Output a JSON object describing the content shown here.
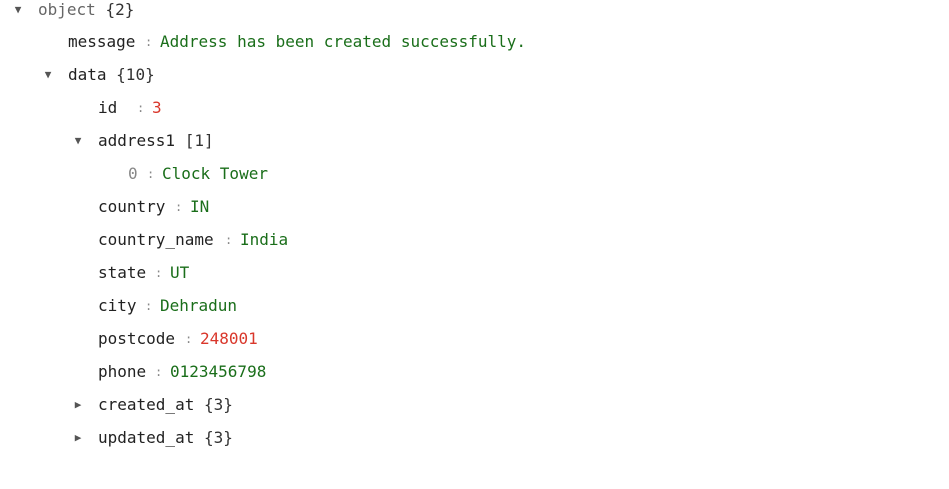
{
  "icons": {
    "expanded": "▼",
    "collapsed": "▶"
  },
  "colors": {
    "string_value": "#1a6e1a",
    "number_value": "#d9372b",
    "key": "#222222",
    "root_key": "#666666",
    "index_key": "#888888"
  },
  "tree": {
    "root": {
      "key": "object",
      "count": "{2}"
    },
    "message": {
      "key": "message",
      "sep": ":",
      "value": "Address has been created successfully."
    },
    "data": {
      "key": "data",
      "count": "{10}"
    },
    "id": {
      "key": "id",
      "sep": ":",
      "value": "3"
    },
    "address1": {
      "key": "address1",
      "count": "[1]"
    },
    "address1_0": {
      "key": "0",
      "sep": ":",
      "value": "Clock Tower"
    },
    "country": {
      "key": "country",
      "sep": ":",
      "value": "IN"
    },
    "country_name": {
      "key": "country_name",
      "sep": ":",
      "value": "India"
    },
    "state": {
      "key": "state",
      "sep": ":",
      "value": "UT"
    },
    "city": {
      "key": "city",
      "sep": ":",
      "value": "Dehradun"
    },
    "postcode": {
      "key": "postcode",
      "sep": ":",
      "value": "248001"
    },
    "phone": {
      "key": "phone",
      "sep": ":",
      "value": "0123456798"
    },
    "created_at": {
      "key": "created_at",
      "count": "{3}"
    },
    "updated_at": {
      "key": "updated_at",
      "count": "{3}"
    }
  }
}
